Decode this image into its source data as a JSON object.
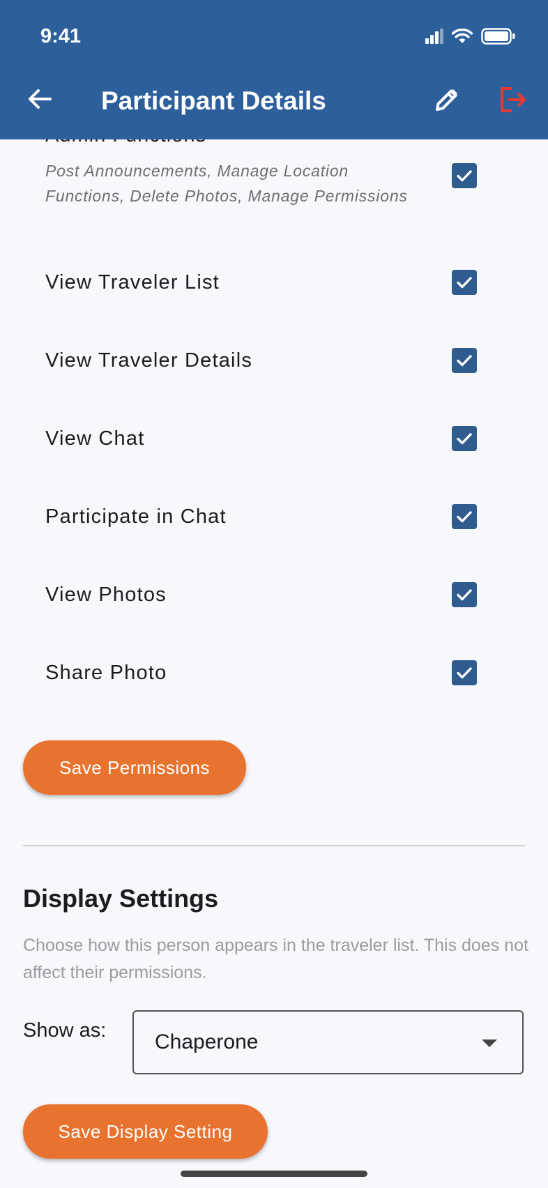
{
  "status_bar": {
    "time": "9:41"
  },
  "app_bar": {
    "title": "Participant Details"
  },
  "permissions": {
    "partial_heading": "Admin Functions",
    "admin_description": "Post Announcements, Manage Location Functions, Delete Photos, Manage Permissions",
    "admin_checked": true,
    "items": [
      {
        "label": "View Traveler List",
        "checked": true
      },
      {
        "label": "View Traveler Details",
        "checked": true
      },
      {
        "label": "View Chat",
        "checked": true
      },
      {
        "label": "Participate in Chat",
        "checked": true
      },
      {
        "label": "View Photos",
        "checked": true
      },
      {
        "label": "Share Photo",
        "checked": true
      }
    ],
    "save_label": "Save Permissions"
  },
  "display_settings": {
    "title": "Display Settings",
    "description": "Choose how this person appears in the traveler list. This does not affect their permissions.",
    "show_as_label": "Show as:",
    "selected_value": "Chaperone",
    "save_label": "Save Display Setting"
  },
  "colors": {
    "app_bar": "#2d5f9a",
    "accent_button": "#e8732f",
    "checkbox": "#2f5b8e",
    "logout_icon": "#e53935",
    "background": "#f7f8fc"
  },
  "icons": {
    "back": "arrow-left-icon",
    "edit": "pencil-icon",
    "logout": "logout-icon",
    "check": "check-icon",
    "dropdown": "caret-down-icon"
  }
}
